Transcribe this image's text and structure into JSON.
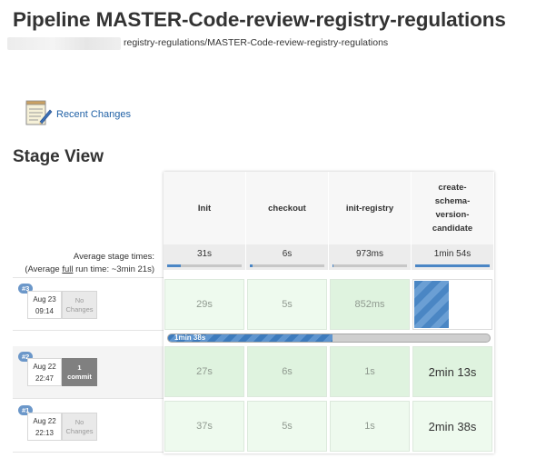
{
  "header": {
    "title": "Pipeline MASTER-Code-review-registry-regulations",
    "breadcrumb_path": "registry-regulations/MASTER-Code-review-registry-regulations"
  },
  "links": {
    "recent_changes": "Recent Changes"
  },
  "stage_view": {
    "title": "Stage View",
    "avg_label": "Average stage times:",
    "full_label_prefix": "(Average ",
    "full_label_link": "full",
    "full_label_suffix": " run time: ~3min 21s)",
    "stages": [
      {
        "name": "Init",
        "avg": "31s",
        "avg_fraction": 0.18
      },
      {
        "name": "checkout",
        "avg": "6s",
        "avg_fraction": 0.04
      },
      {
        "name": "init-registry",
        "avg": "973ms",
        "avg_fraction": 0.01
      },
      {
        "name": "create-\nschema-\nversion-\ncandidate",
        "avg": "1min 54s",
        "avg_fraction": 1.0
      }
    ],
    "builds": [
      {
        "number": "#3",
        "date": "Aug 23",
        "time": "09:14",
        "changes": "No\nChanges",
        "has_commit": false,
        "cells": [
          "29s",
          "5s",
          "852ms",
          ""
        ],
        "progress_label": "1min 38s",
        "progress_fraction": 0.51
      },
      {
        "number": "#2",
        "date": "Aug 22",
        "time": "22:47",
        "changes": "1\ncommit",
        "has_commit": true,
        "cells": [
          "27s",
          "6s",
          "1s",
          "2min 13s"
        ]
      },
      {
        "number": "#1",
        "date": "Aug 22",
        "time": "22:13",
        "changes": "No\nChanges",
        "has_commit": false,
        "cells": [
          "37s",
          "5s",
          "1s",
          "2min 38s"
        ]
      }
    ]
  },
  "colors": {
    "accent_blue": "#4b86c5",
    "success_pale": "#eefaee",
    "success_mid": "#dff3df",
    "link": "#2262a6"
  },
  "icons": {
    "recent_changes": "notepad-icon"
  }
}
